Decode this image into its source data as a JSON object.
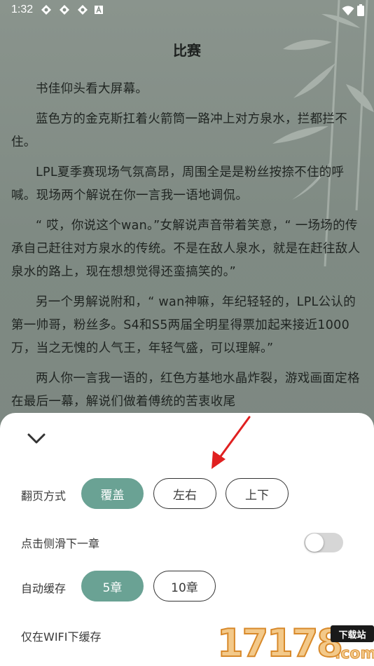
{
  "status_bar": {
    "time": "1:32",
    "icons_left": [
      "vpn-icon",
      "vpn-icon",
      "vpn-icon",
      "text-a-icon"
    ],
    "icons_right": [
      "wifi-icon",
      "battery-icon"
    ]
  },
  "reader": {
    "chapter_title": "比赛",
    "paragraphs": [
      "书佳仰头看大屏幕。",
      "蓝色方的金克斯扛着火箭筒一路冲上对方泉水，拦都拦不住。",
      "LPL夏季赛现场气氛高昂，周围全是是粉丝按捺不住的呼喊。现场两个解说在你一言我一语地调侃。",
      "“ 哎，你说这个wan。”女解说声音带着笑意，“ 一场场的传承自己赶往对方泉水的传统。不是在敌人泉水，就是在赶往敌人泉水的路上，现在想想觉得还蛮搞笑的。”",
      "另一个男解说附和，“ wan神嘛，年纪轻轻的，LPL公认的第一帅哥，粉丝多。S4和S5两届全明星得票加起来接近1000万，当之无愧的人气王，年轻气盛，可以理解。”",
      "两人你一言我一语的，红色方基地水晶炸裂，游戏画面定格在最后一幕，解说们做着傅统的苦衷收尾"
    ]
  },
  "settings_sheet": {
    "page_turn": {
      "label": "翻页方式",
      "options": [
        "覆盖",
        "左右",
        "上下"
      ],
      "selected": "覆盖"
    },
    "tap_side_next": {
      "label": "点击侧滑下一章",
      "enabled": false
    },
    "auto_cache": {
      "label": "自动缓存",
      "options": [
        "5章",
        "10章"
      ],
      "selected": "5章"
    },
    "wifi_only_cache": {
      "label": "仅在WIFI下缓存"
    }
  },
  "watermark": {
    "number": "17178",
    "badge": "下载站",
    "suffix": ".com"
  },
  "colors": {
    "accent": "#6aa294",
    "reader_bg": "#818c85",
    "annotation_arrow": "#e02020"
  }
}
